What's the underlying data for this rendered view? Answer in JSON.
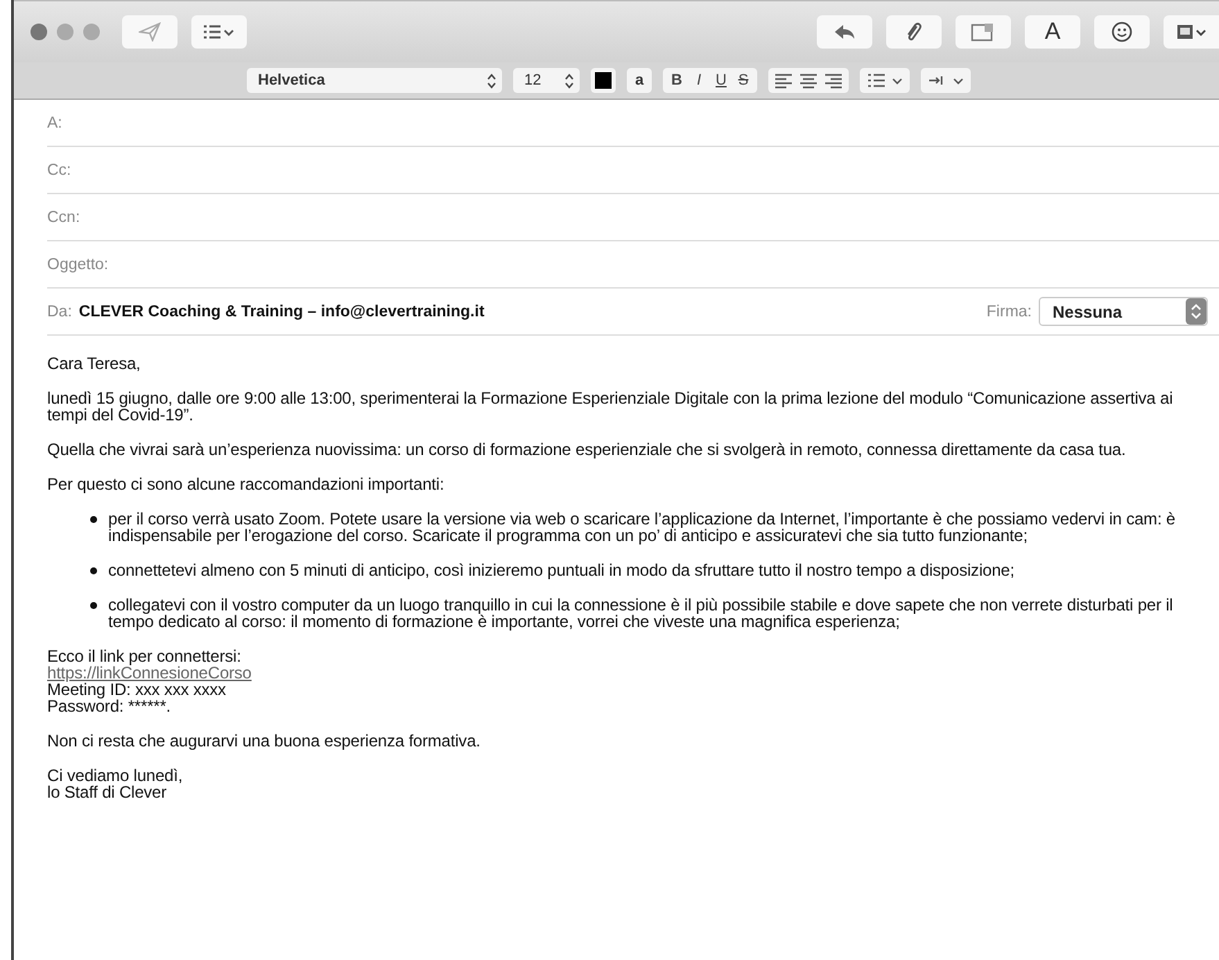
{
  "toolbar": {
    "buttons": [
      {
        "kind": "send",
        "disabled": true
      },
      {
        "kind": "header"
      }
    ],
    "right_buttons": [
      {
        "kind": "reply"
      },
      {
        "kind": "attach"
      },
      {
        "kind": "photo"
      },
      {
        "kind": "font",
        "label": "A"
      },
      {
        "kind": "emoji"
      },
      {
        "kind": "browser"
      }
    ]
  },
  "format_bar": {
    "font": "Helvetica",
    "size": "12",
    "highlight_label": "a",
    "styles": [
      {
        "label": "B",
        "kind": "bold"
      },
      {
        "label": "I",
        "kind": "italic"
      },
      {
        "label": "U",
        "kind": "underline"
      },
      {
        "label": "S",
        "kind": "strike"
      }
    ]
  },
  "header_fields": [
    {
      "label": "A:"
    },
    {
      "label": "Cc:"
    },
    {
      "label": "Ccn:"
    },
    {
      "label": "Oggetto:"
    }
  ],
  "from": {
    "label": "Da:",
    "value": "CLEVER Coaching & Training – info@clevertraining.it",
    "signature_label": "Firma:",
    "signature": "Nessuna"
  },
  "body": [
    {
      "kind": "p",
      "text": "Cara Teresa,"
    },
    {
      "kind": "p",
      "text": "lunedì 15 giugno, dalle ore 9:00 alle 13:00, sperimenterai la Formazione Esperienziale Digitale con la prima lezione del modulo “Comunicazione assertiva ai tempi del Covid-19”."
    },
    {
      "kind": "p",
      "text": "Quella che vivrai sarà un’esperienza nuovissima: un corso di formazione esperienziale che si svolgerà in remoto, connessa direttamente da casa tua."
    },
    {
      "kind": "p",
      "text": "Per questo ci sono alcune raccomandazioni importanti:"
    },
    {
      "kind": "bullet",
      "text": "per il corso verrà usato Zoom. Potete usare la versione via web o scaricare l’applicazione da Internet, l’importante è che possiamo vedervi in cam: è indispensabile per l’erogazione del corso. Scaricate il programma con un po’ di anticipo e assicuratevi che sia tutto funzionante;"
    },
    {
      "kind": "bullet",
      "text": "connettetevi almeno con 5 minuti di anticipo, così inizieremo puntuali in modo da sfruttare tutto il nostro tempo a disposizione;"
    },
    {
      "kind": "bullet",
      "text": "collegatevi con il vostro computer da un luogo tranquillo in cui la connessione è il più possibile stabile e dove sapete che non verrete disturbati per il tempo dedicato al corso: il momento di formazione è importante, vorrei che viveste una magnifica esperienza;"
    },
    {
      "kind": "lines",
      "lines": [
        {
          "kind": "text",
          "text": "Ecco il link per connettersi:"
        },
        {
          "kind": "link",
          "text": "https://linkConnesioneCorso"
        },
        {
          "kind": "text",
          "text": "Meeting ID: xxx xxx xxxx"
        },
        {
          "kind": "text",
          "text": "Password: ******."
        }
      ]
    },
    {
      "kind": "p",
      "text": "Non ci resta che augurarvi una buona esperienza formativa."
    },
    {
      "kind": "lines",
      "lines": [
        {
          "kind": "text",
          "text": "Ci vediamo lunedì,"
        },
        {
          "kind": "text",
          "text": "lo Staff di Clever"
        }
      ]
    }
  ]
}
